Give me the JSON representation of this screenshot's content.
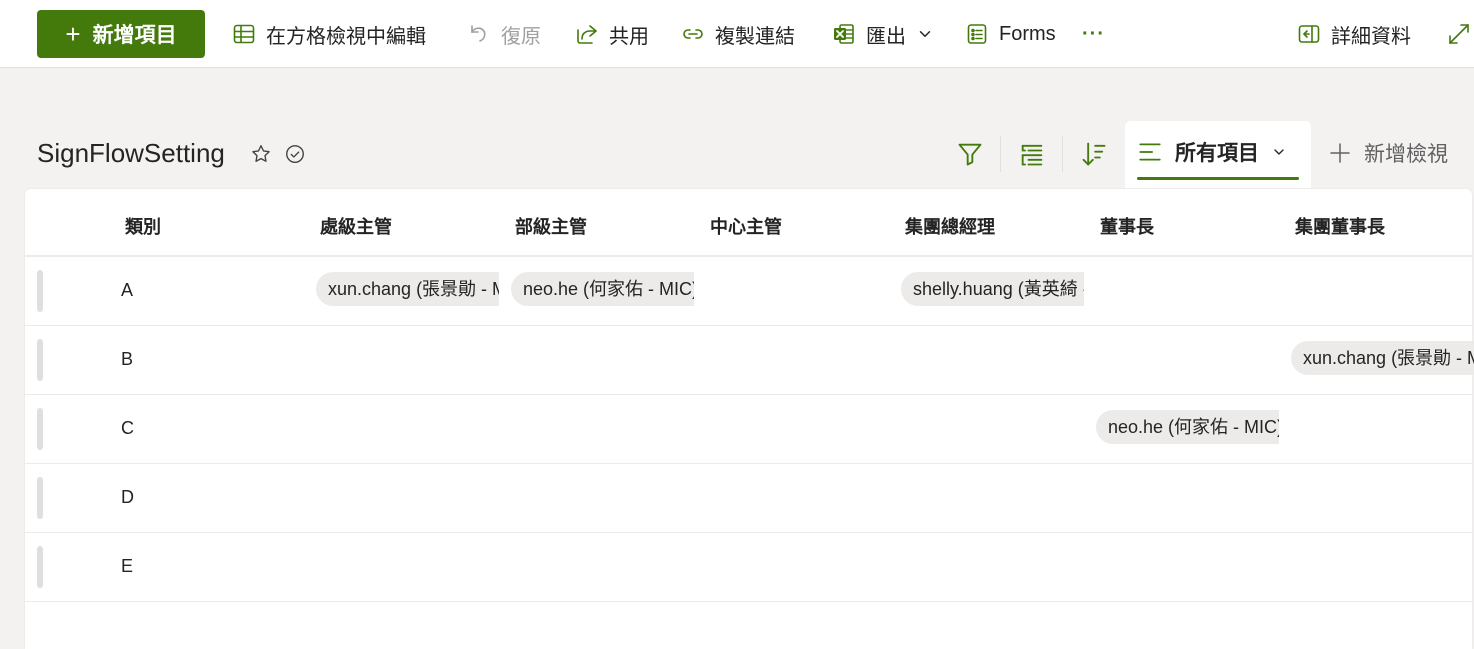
{
  "toolbar": {
    "new_item": "新增項目",
    "grid_edit": "在方格檢視中編輯",
    "undo": "復原",
    "share": "共用",
    "copy_link": "複製連結",
    "export": "匯出",
    "forms": "Forms",
    "more": "···",
    "details": "詳細資料"
  },
  "list": {
    "title": "SignFlowSetting",
    "view_name": "所有項目",
    "add_view": "新增檢視"
  },
  "columns": [
    "類別",
    "處級主管",
    "部級主管",
    "中心主管",
    "集團總經理",
    "董事長",
    "集團董事長"
  ],
  "rows": [
    {
      "category": "A",
      "people": [
        "xun.chang (張景勛 - MIC)",
        "neo.he (何家佑 - MIC)",
        "shelly.huang (黃英綺 - MIC)"
      ]
    },
    {
      "category": "B",
      "people": [
        "xun.chang (張景勛 - MIC)"
      ]
    },
    {
      "category": "C",
      "people": [
        "neo.he (何家佑 - MIC)"
      ]
    },
    {
      "category": "D",
      "people": []
    },
    {
      "category": "E",
      "people": []
    }
  ],
  "colors": {
    "accent": "#437a0b",
    "pill_bg": "#edebe9",
    "page_bg": "#f3f2f1"
  },
  "icons": [
    "plus-icon",
    "grid-icon",
    "undo-icon",
    "share-icon",
    "link-icon",
    "excel-icon",
    "chevron-down-icon",
    "forms-icon",
    "more-icon",
    "details-pane-icon",
    "expand-icon",
    "star-icon",
    "check-circle-icon",
    "filter-icon",
    "group-icon",
    "sort-icon",
    "view-list-icon"
  ]
}
